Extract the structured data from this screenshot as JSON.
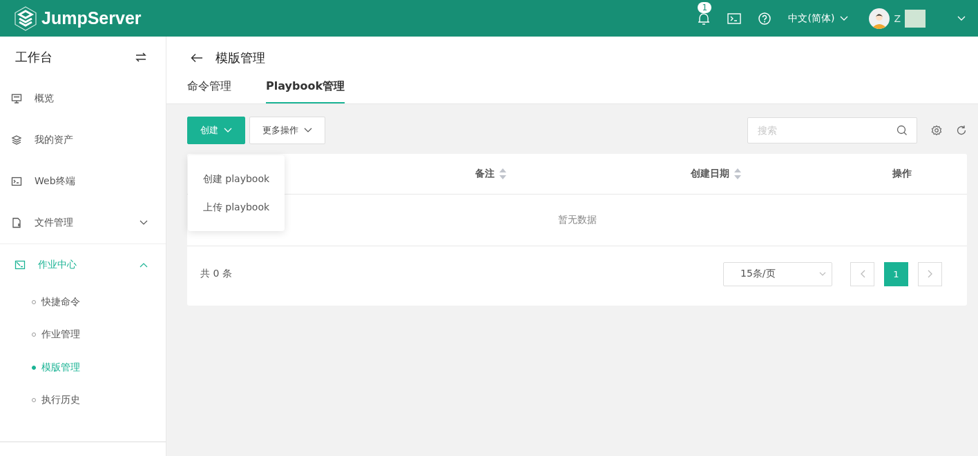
{
  "header": {
    "logo": "JumpServer",
    "notification_count": "1",
    "language": "中文(简体)",
    "user_name": "Z"
  },
  "sidebar": {
    "title": "工作台",
    "items": [
      {
        "kind": "link",
        "label": "概览",
        "selected": false
      },
      {
        "kind": "link",
        "label": "我的资产",
        "selected": false
      },
      {
        "kind": "link",
        "label": "Web终端",
        "selected": false
      },
      {
        "kind": "group",
        "label": "文件管理",
        "selected": false,
        "expanded": false
      },
      {
        "kind": "group",
        "label": "作业中心",
        "selected": true,
        "expanded": true,
        "children": [
          {
            "label": "快捷命令",
            "selected": false
          },
          {
            "label": "作业管理",
            "selected": false
          },
          {
            "label": "模版管理",
            "selected": true
          },
          {
            "label": "执行历史",
            "selected": false
          }
        ]
      }
    ]
  },
  "page": {
    "title": "模版管理",
    "tabs": [
      {
        "label": "命令管理",
        "selected": false
      },
      {
        "label": "Playbook管理",
        "selected": true
      }
    ]
  },
  "toolbar": {
    "create_button": "创建",
    "more_button": "更多操作",
    "search": {
      "placeholder": "搜索"
    }
  },
  "dropdown": {
    "items": [
      "创建 playbook",
      "上传 playbook"
    ]
  },
  "table": {
    "columns": [
      {
        "label": "备注",
        "sortable": true
      },
      {
        "label": "创建日期",
        "sortable": true
      },
      {
        "label": "操作",
        "sortable": false
      }
    ],
    "empty_text": "暂无数据"
  },
  "pagination": {
    "total": "共 0 条",
    "page_size": "15条/页",
    "pages": [
      {
        "label": "1",
        "selected": true
      }
    ]
  }
}
